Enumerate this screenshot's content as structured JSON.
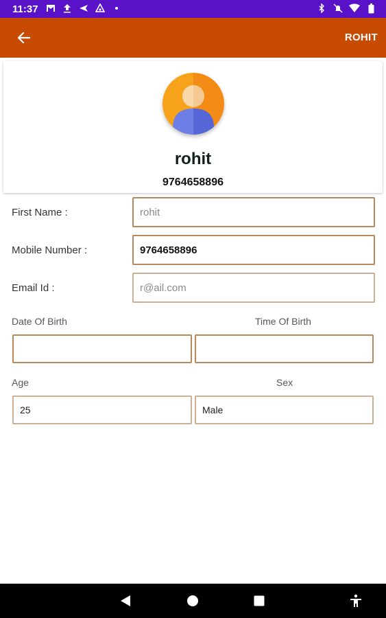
{
  "status_bar": {
    "time": "11:37",
    "left_icons": [
      "gmail-icon",
      "upload-icon",
      "send-icon",
      "android-icon",
      "dot-icon"
    ],
    "right_icons": [
      "bluetooth-icon",
      "mute-icon",
      "wifi-icon",
      "battery-icon"
    ]
  },
  "app_bar": {
    "title": "ROHIT",
    "back_icon": "arrow-left-icon"
  },
  "profile": {
    "name": "rohit",
    "phone": "9764658896"
  },
  "form": {
    "first_name_label": "First Name :",
    "first_name_value": "rohit",
    "mobile_label": "Mobile Number :",
    "mobile_value": "9764658896",
    "email_label": "Email Id :",
    "email_value": "r@ail.com",
    "dob_label": "Date Of Birth",
    "dob_value": "",
    "tob_label": "Time Of Birth",
    "tob_value": "",
    "age_label": "Age",
    "age_value": "25",
    "sex_label": "Sex",
    "sex_value": "Male"
  },
  "colors": {
    "status_bar": "#5a12c8",
    "app_bar": "#c84b03",
    "field_border": "#b8875a"
  },
  "nav_bar": [
    "back-triangle-icon",
    "home-circle-icon",
    "recents-square-icon",
    "accessibility-icon"
  ]
}
